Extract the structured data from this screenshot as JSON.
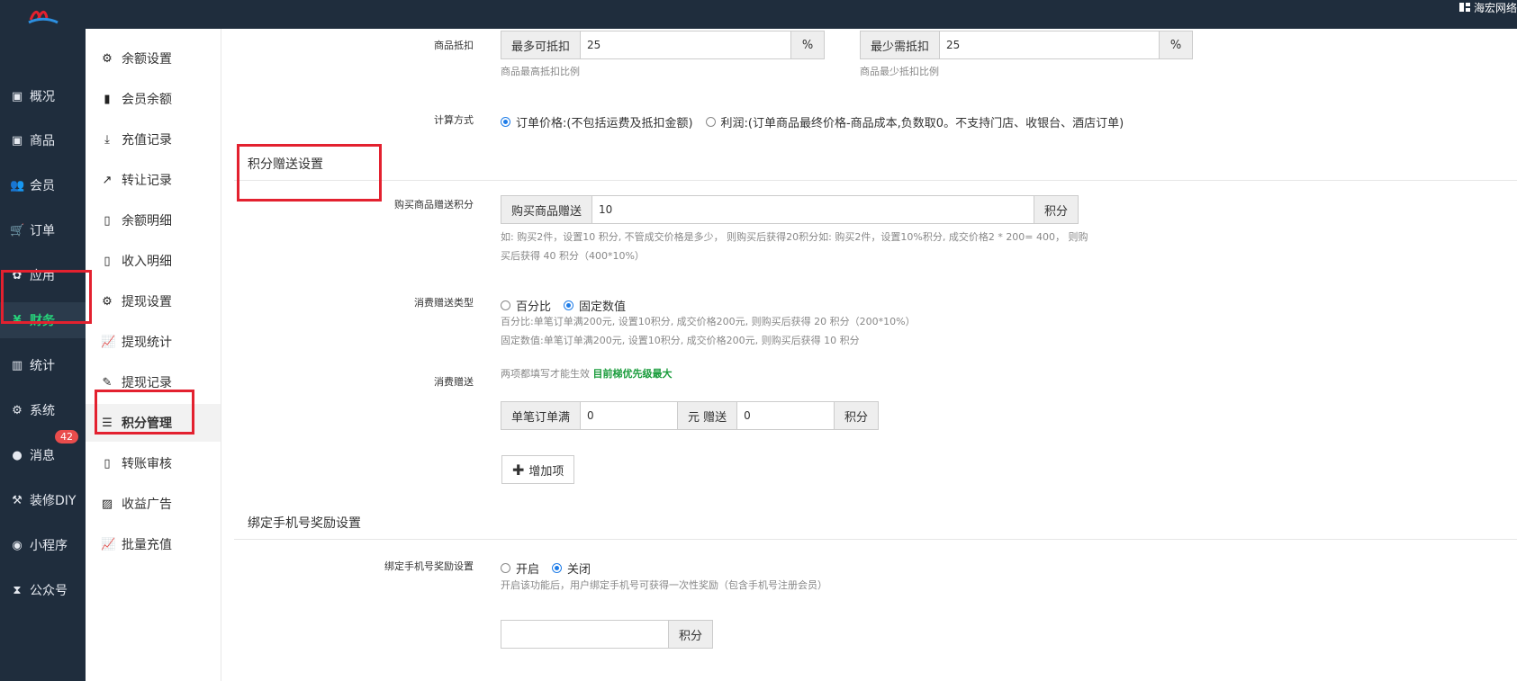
{
  "topbar": {
    "right_text": "海宏网络"
  },
  "leftnav": {
    "items": [
      {
        "label": "概况",
        "icon": "overview-icon",
        "glyph": "▣"
      },
      {
        "label": "商品",
        "icon": "goods-icon",
        "glyph": "▣"
      },
      {
        "label": "会员",
        "icon": "users-icon",
        "glyph": "👥"
      },
      {
        "label": "订单",
        "icon": "cart-icon",
        "glyph": "🛒"
      },
      {
        "label": "应用",
        "icon": "apps-icon",
        "glyph": "✿"
      },
      {
        "label": "财务",
        "icon": "yen-icon",
        "glyph": "¥"
      },
      {
        "label": "统计",
        "icon": "bar-chart-icon",
        "glyph": "▥"
      },
      {
        "label": "系统",
        "icon": "gears-icon",
        "glyph": "⚙"
      },
      {
        "label": "消息",
        "icon": "comment-icon",
        "glyph": "●"
      },
      {
        "label": "装修DIY",
        "icon": "gavel-icon",
        "glyph": "⚒"
      },
      {
        "label": "小程序",
        "icon": "wechat-icon",
        "glyph": "◉"
      },
      {
        "label": "公众号",
        "icon": "hourglass-icon",
        "glyph": "⧗"
      }
    ],
    "message_badge": "42"
  },
  "subnav": {
    "items": [
      {
        "label": "余额设置",
        "icon": "gear-icon",
        "glyph": "⚙"
      },
      {
        "label": "会员余额",
        "icon": "book-icon",
        "glyph": "▮"
      },
      {
        "label": "充值记录",
        "icon": "download-icon",
        "glyph": "⤓"
      },
      {
        "label": "转让记录",
        "icon": "external-link-icon",
        "glyph": "↗"
      },
      {
        "label": "余额明细",
        "icon": "file-icon",
        "glyph": "▯"
      },
      {
        "label": "收入明细",
        "icon": "file-icon",
        "glyph": "▯"
      },
      {
        "label": "提现设置",
        "icon": "gear-icon",
        "glyph": "⚙"
      },
      {
        "label": "提现统计",
        "icon": "line-chart-icon",
        "glyph": "📈"
      },
      {
        "label": "提现记录",
        "icon": "pencil-icon",
        "glyph": "✎"
      },
      {
        "label": "积分管理",
        "icon": "database-icon",
        "glyph": "☰"
      },
      {
        "label": "转账审核",
        "icon": "file-icon",
        "glyph": "▯"
      },
      {
        "label": "收益广告",
        "icon": "image-icon",
        "glyph": "▨"
      },
      {
        "label": "批量充值",
        "icon": "line-chart-icon",
        "glyph": "📈"
      }
    ]
  },
  "deduct": {
    "label": "商品抵扣",
    "max_addon": "最多可抵扣",
    "max_value": "25",
    "max_unit": "%",
    "max_hint": "商品最高抵扣比例",
    "min_addon": "最少需抵扣",
    "min_value": "25",
    "min_unit": "%",
    "min_hint": "商品最少抵扣比例"
  },
  "calc": {
    "label": "计算方式",
    "opt1": "订单价格:(不包括运费及抵扣金额)",
    "opt2": "利润:(订单商品最终价格-商品成本,负数取0。不支持门店、收银台、酒店订单)"
  },
  "gift_section": {
    "title": "积分赠送设置"
  },
  "buy_gift": {
    "label": "购买商品赠送积分",
    "addon": "购买商品赠送",
    "value": "10",
    "unit": "积分",
    "hint1": "如: 购买2件，设置10 积分, 不管成交价格是多少， 则购买后获得20积分如: 购买2件，设置10%积分, 成交价格2 * 200= 400， 则购",
    "hint2": "买后获得 40 积分（400*10%）"
  },
  "consume_type": {
    "label": "消费赠送类型",
    "opt1": "百分比",
    "opt2": "固定数值",
    "hint1": "百分比:单笔订单满200元, 设置10积分, 成交价格200元, 则购买后获得 20 积分（200*10%）",
    "hint2": "固定数值:单笔订单满200元, 设置10积分, 成交价格200元, 则购买后获得 10 积分"
  },
  "consume_gift": {
    "label": "消费赠送",
    "hint_prefix": "两项都填写才能生效 ",
    "hint_green": "目前梯优先级最大",
    "addon1": "单笔订单满",
    "value1": "0",
    "addon2": "元 赠送",
    "value2": "0",
    "unit": "积分",
    "add_button": "增加项"
  },
  "bind_section": {
    "title": "绑定手机号奖励设置"
  },
  "bind": {
    "label": "绑定手机号奖励设置",
    "opt_on": "开启",
    "opt_off": "关闭",
    "hint": "开启该功能后，用户绑定手机号可获得一次性奖励（包含手机号注册会员）",
    "value": "",
    "unit": "积分"
  }
}
